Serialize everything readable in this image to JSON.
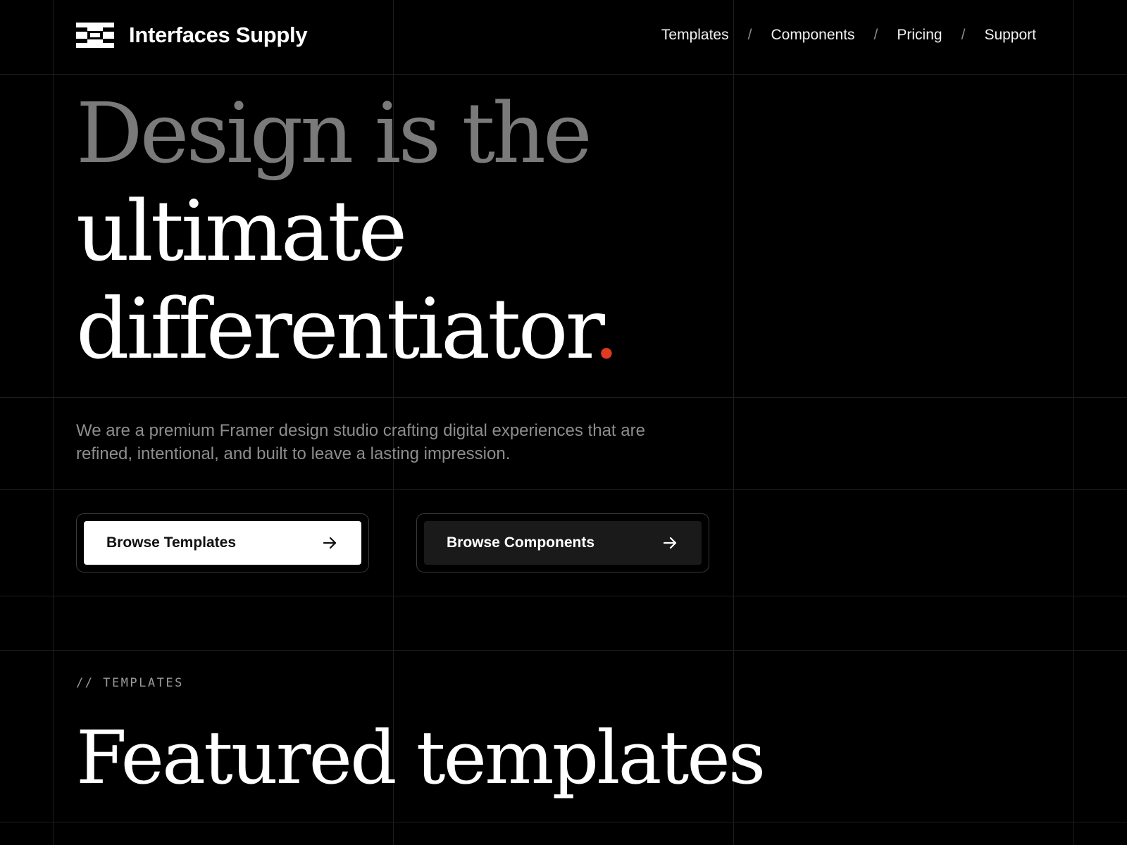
{
  "brand": {
    "name": "Interfaces Supply",
    "logo_icon": "boxed-bars-logo-icon"
  },
  "nav": {
    "items": [
      {
        "label": "Templates"
      },
      {
        "label": "Components"
      },
      {
        "label": "Pricing"
      },
      {
        "label": "Support"
      }
    ],
    "separator": "/"
  },
  "hero": {
    "line1": "Design is the",
    "line2": "ultimate",
    "line3": "differentiator",
    "accent": ".",
    "accent_color": "#e03a22",
    "subtitle": "We are a premium Framer design studio crafting digital experiences that are refined, intentional, and built to leave a lasting impression."
  },
  "buttons": {
    "primary": {
      "label": "Browse Templates",
      "icon": "arrow-right-icon"
    },
    "secondary": {
      "label": "Browse Components",
      "icon": "arrow-right-icon"
    }
  },
  "section": {
    "eyebrow": "// TEMPLATES",
    "title": "Featured templates"
  },
  "colors": {
    "background": "#000000",
    "grid": "#1d1d1d",
    "muted_text": "#8d8d8d",
    "heading_muted": "#7a7a7a"
  }
}
